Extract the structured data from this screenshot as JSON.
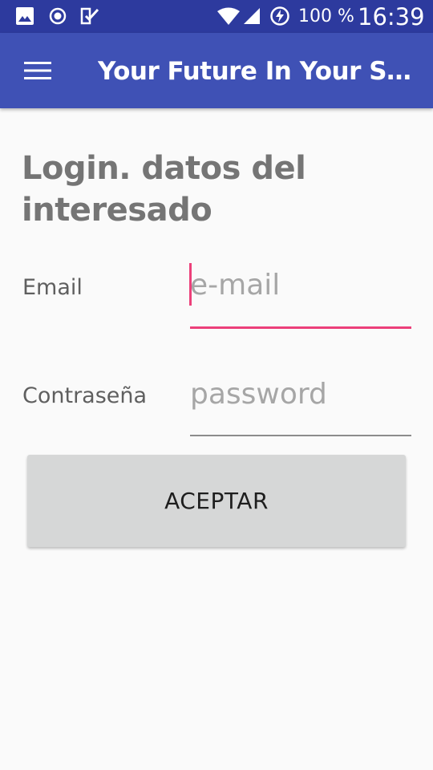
{
  "status_bar": {
    "battery_text": "100 %",
    "time": "16:39",
    "icons": [
      "image-icon",
      "record-icon",
      "checklist-icon",
      "wifi-icon",
      "signal-icon",
      "battery-saver-icon"
    ]
  },
  "app_bar": {
    "title": "Your Future In Your Smartphone",
    "menu_icon": "menu-icon"
  },
  "form": {
    "heading": "Login. datos del interesado",
    "email": {
      "label": "Email",
      "placeholder": "e-mail",
      "value": ""
    },
    "password": {
      "label": "Contraseña",
      "placeholder": "password",
      "value": ""
    },
    "submit_label": "ACEPTAR"
  },
  "colors": {
    "status_bar": "#2d3a9e",
    "app_bar": "#3f51b5",
    "accent": "#ec407a",
    "background": "#fafafa",
    "button": "#d6d7d7"
  }
}
